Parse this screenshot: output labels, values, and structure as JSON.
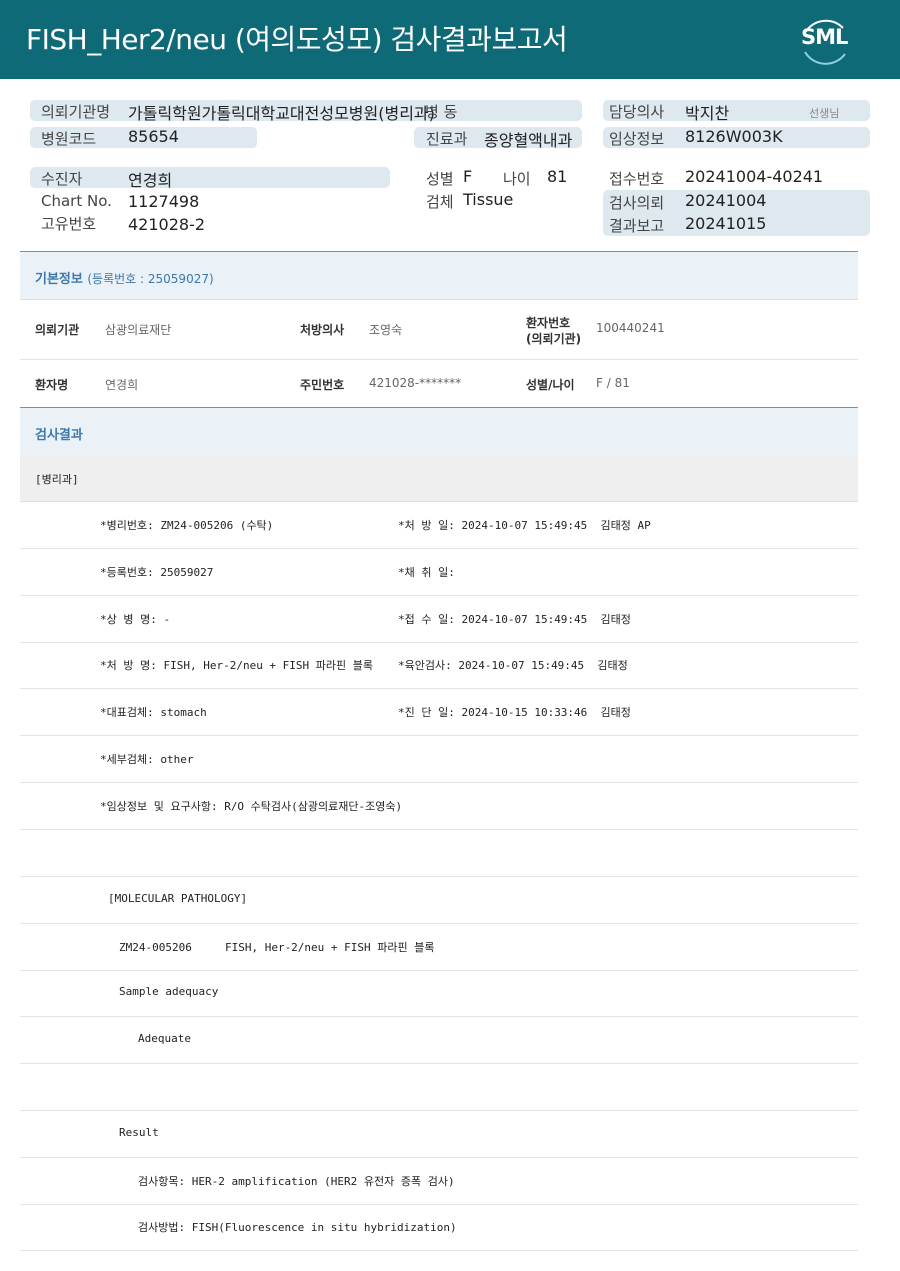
{
  "header": {
    "title": "FISH_Her2/neu  (여의도성모) 검사결과보고서",
    "logo_text": "SML"
  },
  "info": {
    "requester_label": "의뢰기관명",
    "requester_value": "가톨릭학원가톨릭대학교대전성모병원(병리과)",
    "ward_label": "병  동",
    "doctor_label": "담당의사",
    "doctor_value": "박지찬",
    "doctor_suffix": "선생님",
    "hospital_code_label": "병원코드",
    "hospital_code_value": "85654",
    "dept_label": "진료과",
    "dept_value": "종양혈액내과",
    "clinical_label": "임상정보",
    "clinical_value": "8126W003K",
    "patient_label": "수진자",
    "patient_value": "연경희",
    "sex_label": "성별",
    "sex_value": "F",
    "age_label": "나이",
    "age_value": "81",
    "receipt_label": "접수번호",
    "receipt_value": "20241004-40241",
    "chart_label": "Chart No.",
    "chart_value": "1127498",
    "specimen_label": "검체",
    "specimen_value": "Tissue",
    "request_date_label": "검사의뢰",
    "request_date_value": "20241004",
    "unique_label": "고유번호",
    "unique_value": "421028-2",
    "report_date_label": "결과보고",
    "report_date_value": "20241015"
  },
  "basic": {
    "title": "기본정보",
    "reg_note": "(등록번호 : 25059027)",
    "rows": [
      {
        "k1": "의뢰기관",
        "v1": "삼광의료재단",
        "k2": "처방의사",
        "v2": "조영숙",
        "k3a": "환자번호",
        "k3b": "(의뢰기관)",
        "v3": "100440241"
      },
      {
        "k1": "환자명",
        "v1": "연경희",
        "k2": "주민번호",
        "v2": "421028-*******",
        "k3": "성별/나이",
        "v3": "F / 81"
      }
    ]
  },
  "results": {
    "title": "검사결과",
    "dept": "[병리과]",
    "lines": [
      {
        "left": "*병리번호: ZM24-005206 (수탁)",
        "right": "*처 방 일: 2024-10-07 15:49:45  김태정 AP"
      },
      {
        "left": "*등록번호: 25059027",
        "right": "*채 취 일:"
      },
      {
        "left": "*상 병 명: -",
        "right": "*접 수 일: 2024-10-07 15:49:45  김태정"
      },
      {
        "left": "*처 방 명: FISH, Her-2/neu + FISH 파라핀 블록",
        "right": "*육안검사: 2024-10-07 15:49:45  김태정"
      },
      {
        "left": "*대표검체: stomach",
        "right": "*진 단 일: 2024-10-15 10:33:46  김태정"
      },
      {
        "left": "*세부검체: other",
        "right": ""
      },
      {
        "left": "*임상정보 및 요구사항: R/O 수탁검사(삼광의료재단-조영숙)",
        "right": ""
      }
    ],
    "report_lines": [
      {
        "text": "",
        "indent": 0
      },
      {
        "text": "[MOLECULAR PATHOLOGY]",
        "indent": 1
      },
      {
        "text": "ZM24-005206     FISH, Her-2/neu + FISH 파라핀 블록",
        "indent": 2
      },
      {
        "text": "Sample adequacy",
        "indent": 2
      },
      {
        "text": "Adequate",
        "indent": 3
      },
      {
        "text": "",
        "indent": 0
      },
      {
        "text": "Result",
        "indent": 2
      },
      {
        "text": "검사항목: HER-2 amplification (HER2 유전자 증폭 검사)",
        "indent": 3
      },
      {
        "text": "검사방법: FISH(Fluorescence in situ hybridization)",
        "indent": 3
      }
    ]
  }
}
